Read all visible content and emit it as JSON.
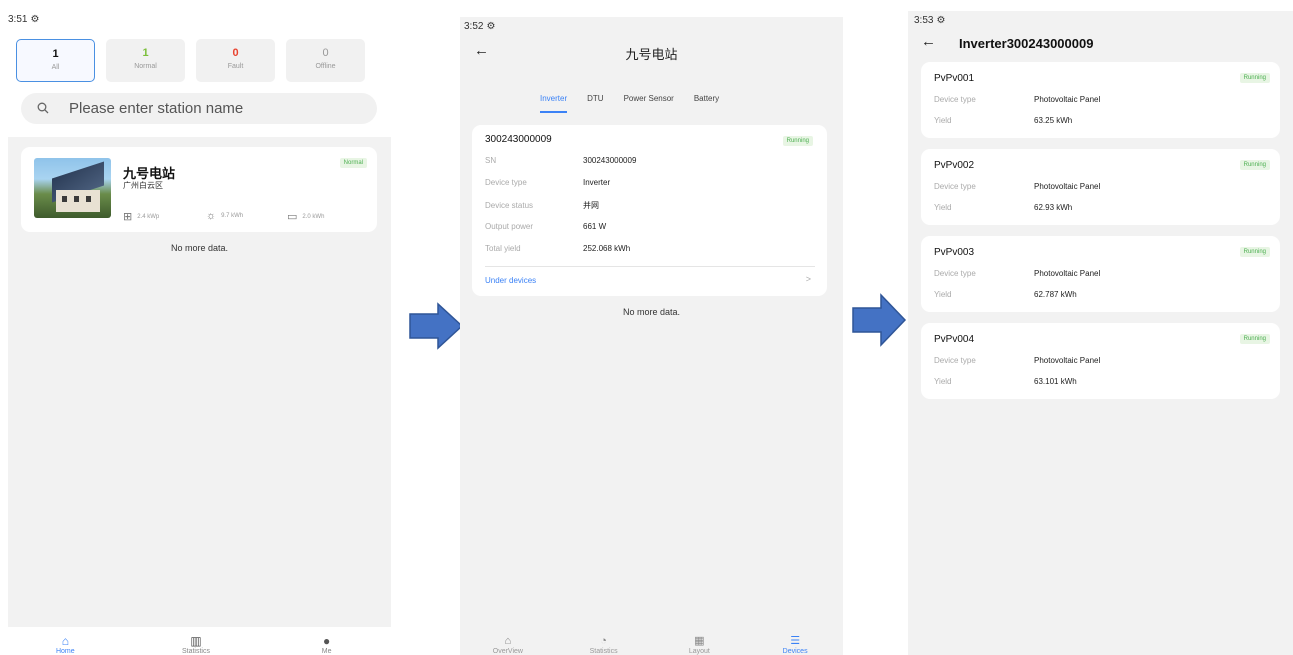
{
  "screen1": {
    "status_time": "3:51",
    "stats": [
      {
        "num": "1",
        "label": "All",
        "color": "black"
      },
      {
        "num": "1",
        "label": "Normal",
        "color": "green"
      },
      {
        "num": "0",
        "label": "Fault",
        "color": "red"
      },
      {
        "num": "0",
        "label": "Offline",
        "color": "grey"
      }
    ],
    "search_placeholder": "Please enter station name",
    "station": {
      "name": "九号电站",
      "location": "广州白云区",
      "status": "Normal",
      "capacity": "2.4 kWp",
      "energy_today": "9.7 kWh",
      "battery": "2.0 kWh"
    },
    "empty_text": "No more data.",
    "tabbar": [
      "Home",
      "Statistics",
      "Me"
    ]
  },
  "screen2": {
    "status_time": "3:52",
    "title": "九号电站",
    "tabs": [
      "Inverter",
      "DTU",
      "Power Sensor",
      "Battery"
    ],
    "inverter": {
      "title": "300243000009",
      "status": "Running",
      "rows": [
        {
          "k": "SN",
          "v": "300243000009"
        },
        {
          "k": "Device type",
          "v": "Inverter"
        },
        {
          "k": "Device status",
          "v": "并网"
        },
        {
          "k": "Output power",
          "v": "661 W"
        },
        {
          "k": "Total yield",
          "v": "252.068 kWh"
        }
      ],
      "under_devices": "Under devices"
    },
    "empty_text": "No more data.",
    "tabbar": [
      "OverView",
      "Statistics",
      "Layout",
      "Devices"
    ]
  },
  "screen3": {
    "status_time": "3:53",
    "title": "Inverter300243000009",
    "devices": [
      {
        "name": "PvPv001",
        "status": "Running",
        "type_label": "Device type",
        "type": "Photovoltaic Panel",
        "yield_label": "Yield",
        "yield": "63.25 kWh"
      },
      {
        "name": "PvPv002",
        "status": "Running",
        "type_label": "Device type",
        "type": "Photovoltaic Panel",
        "yield_label": "Yield",
        "yield": "62.93 kWh"
      },
      {
        "name": "PvPv003",
        "status": "Running",
        "type_label": "Device type",
        "type": "Photovoltaic Panel",
        "yield_label": "Yield",
        "yield": "62.787 kWh"
      },
      {
        "name": "PvPv004",
        "status": "Running",
        "type_label": "Device type",
        "type": "Photovoltaic Panel",
        "yield_label": "Yield",
        "yield": "63.101 kWh"
      }
    ]
  },
  "colors": {
    "accent": "#3b82f6",
    "arrow": "#4472c4",
    "green": "#4caf50",
    "red": "#e94430"
  }
}
